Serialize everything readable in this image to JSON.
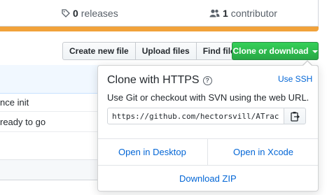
{
  "summary": {
    "releases_count": "0",
    "releases_label": "releases",
    "contributors_count": "1",
    "contributors_label": "contributor",
    "accent_color": "#f1a23a"
  },
  "toolbar": {
    "create_file": "Create new file",
    "upload_files": "Upload files",
    "find_file": "Find file",
    "clone_download": "Clone or download"
  },
  "file_list": {
    "rows": [
      {
        "text": "nce init"
      },
      {
        "text": "ready to go"
      }
    ]
  },
  "clone_popover": {
    "title": "Clone with HTTPS",
    "help_icon": "question-circle-icon",
    "use_ssh": "Use SSH",
    "description": "Use Git or checkout with SVN using the web URL.",
    "url": "https://github.com/hectorsvill/ATrack",
    "copy_icon": "clipboard-icon",
    "open_desktop": "Open in Desktop",
    "open_xcode": "Open in Xcode",
    "download_zip": "Download ZIP"
  },
  "colors": {
    "link": "#0366d6",
    "primary_button": "#28a745"
  }
}
